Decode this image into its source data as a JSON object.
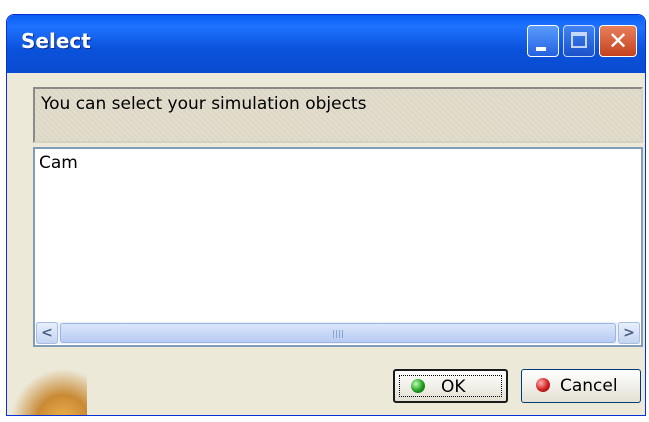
{
  "window": {
    "title": "Select",
    "controls": {
      "minimize": "minimize-icon",
      "maximize": "maximize-icon",
      "close": "close-icon",
      "close_glyph": "✕"
    }
  },
  "message": {
    "text": "You can select your simulation objects"
  },
  "list": {
    "items": [
      "Cam"
    ]
  },
  "scrollbar": {
    "left_arrow": "<",
    "right_arrow": ">"
  },
  "buttons": {
    "ok_label": "OK",
    "cancel_label": "Cancel"
  },
  "colors": {
    "titlebar": "#0a52db",
    "dialog_bg": "#ece9d8",
    "ok_icon": "#1f9b1f",
    "cancel_icon": "#d01f1f"
  }
}
